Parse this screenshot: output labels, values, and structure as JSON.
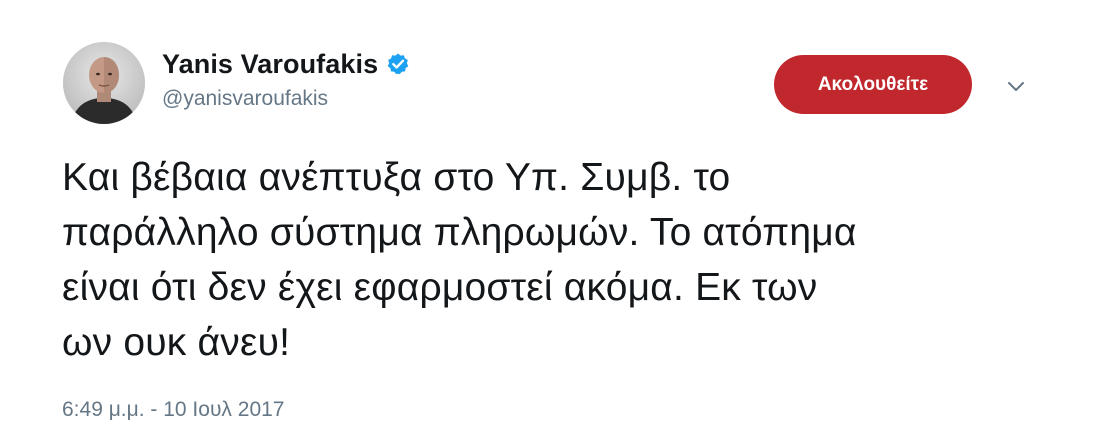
{
  "tweet": {
    "author": {
      "display_name": "Yanis Varoufakis",
      "handle": "@yanisvaroufakis",
      "verified": true,
      "avatar_icon": "profile-photo"
    },
    "follow_button_label": "Ακολουθείτε",
    "menu_icon": "chevron-down-icon",
    "text_lines": [
      "Και βέβαια ανέπτυξα στο Υπ. Συμβ. το",
      "παράλληλο σύστημα πληρωμών. Το ατόπημα",
      "είναι ότι δεν έχει εφαρμοστεί ακόμα. Εκ των",
      "ων ουκ άνευ!"
    ],
    "timestamp": "6:49 μ.μ. - 10 Ιουλ 2017"
  },
  "colors": {
    "follow_button_bg": "#c0282d",
    "verified_badge": "#1da1f2",
    "secondary_text": "#657786",
    "primary_text": "#14171a"
  }
}
